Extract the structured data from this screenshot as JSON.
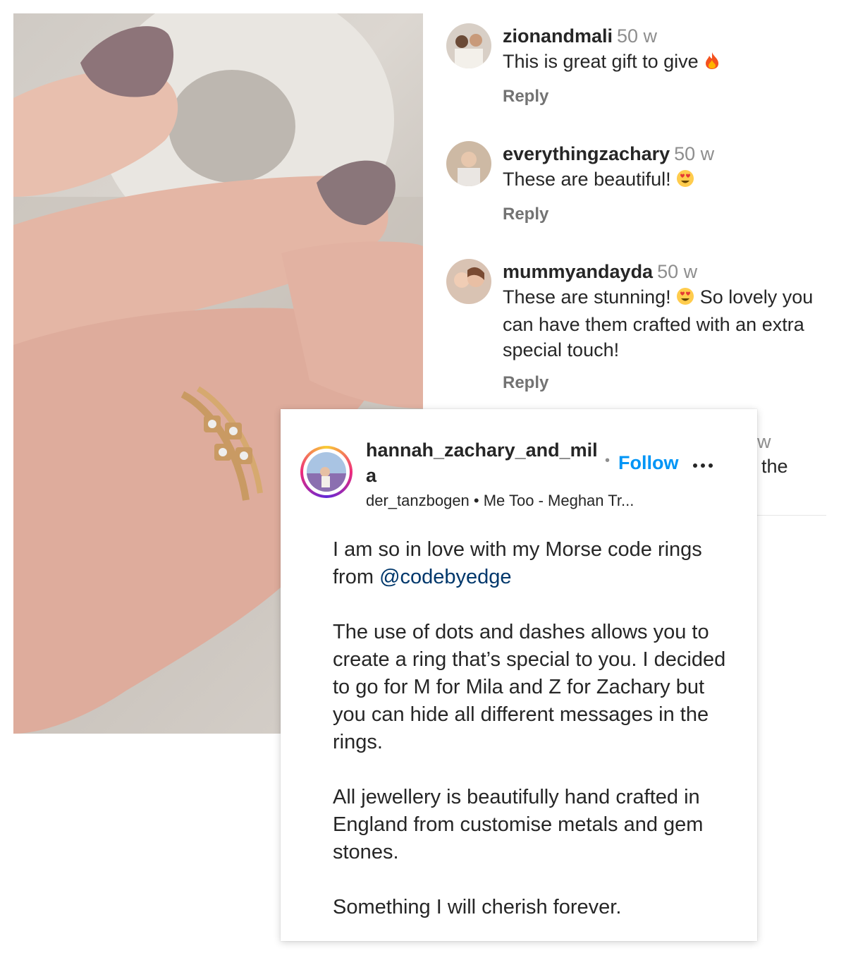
{
  "photo": {
    "icon": "hand-with-rings-photo"
  },
  "comments": [
    {
      "username": "zionandmali",
      "time": "50 w",
      "text": "This is great gift to give",
      "emoji": "fire",
      "reply": "Reply"
    },
    {
      "username": "everythingzachary",
      "time": "50 w",
      "text": "These are beautiful!",
      "emoji": "heart-eyes",
      "reply": "Reply"
    },
    {
      "username": "mummyandayda",
      "time": "50 w",
      "text_before": "These are stunning!",
      "emoji": "heart-eyes",
      "text_after": "So lovely you can have them crafted with an extra special touch!",
      "reply": "Reply"
    }
  ],
  "hidden_comment": {
    "time_fragment": "w",
    "text_fragment": "the"
  },
  "post": {
    "username": "hannah_zachary_and_mila",
    "follow_separator": "•",
    "follow_label": "Follow",
    "audio": "der_tanzbogen • Me Too - Meghan Tr...",
    "caption": {
      "p1_text": "I am so in love with my Morse code rings from ",
      "p1_mention": "@codebyedge",
      "p2": "The use of dots and dashes allows you to create a ring that’s special to you. I decided to go for M for Mila and Z for Zachary but you can hide all different messages in the rings.",
      "p3": "All jewellery is beautifully hand crafted in England from customise metals and gem stones.",
      "p4": "Something I will cherish forever."
    }
  },
  "colors": {
    "follow": "#0095f6",
    "mention": "#00376b",
    "muted": "#8e8e8e"
  }
}
